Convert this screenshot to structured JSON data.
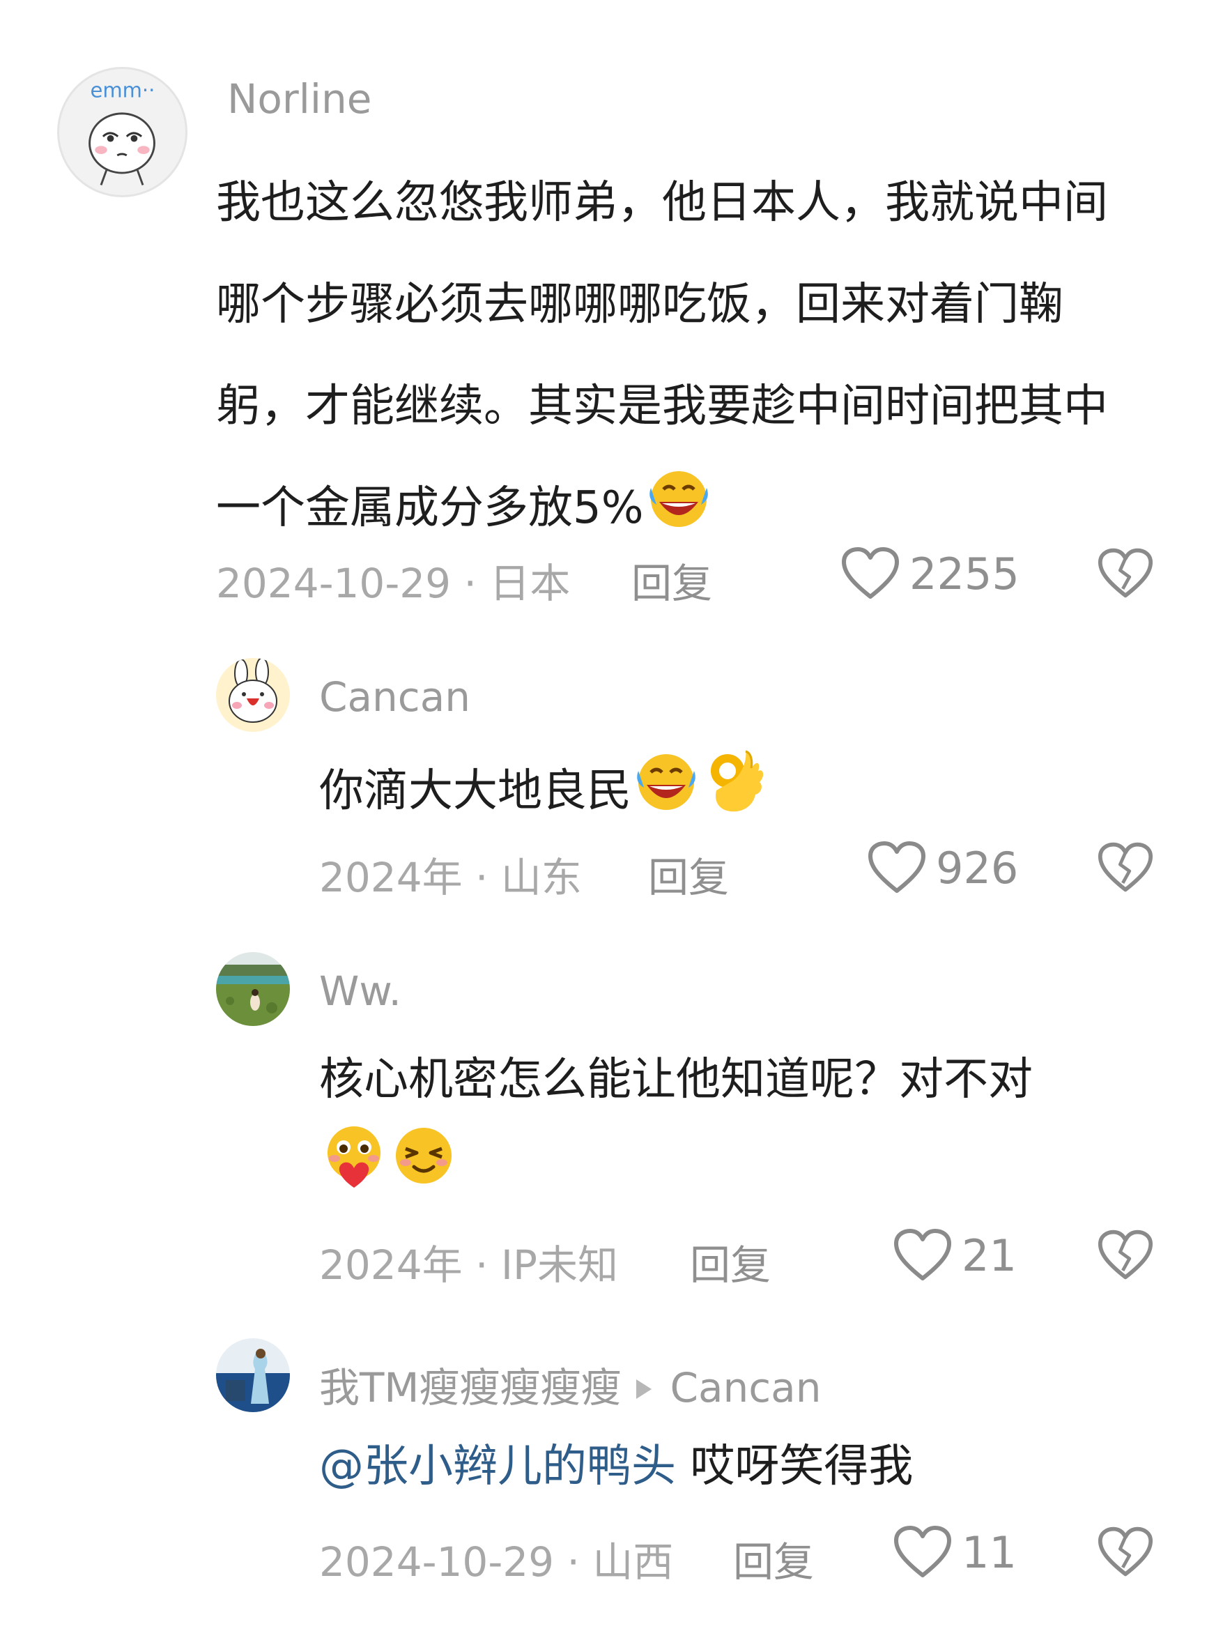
{
  "comments": [
    {
      "username": "Norline",
      "avatar_label": "emm··",
      "text": "我也这么忽悠我师弟，他日本人，我就说中间哪个步骤必须去哪哪哪吃饭，回来对着门鞠躬，才能继续。其实是我要趁中间时间把其中一个金属成分多放5%",
      "emojis": [
        "laughing-crying-emoji"
      ],
      "date_location": "2024-10-29 · 日本",
      "reply_label": "回复",
      "likes": "2255"
    },
    {
      "username": "Cancan",
      "text": "你滴大大地良民",
      "emojis": [
        "laughing-crying-emoji",
        "ok-hand-emoji"
      ],
      "date_location": "2024年 · 山东",
      "reply_label": "回复",
      "likes": "926"
    },
    {
      "username": "Ww.",
      "text": "核心机密怎么能让他知道呢？对不对",
      "emojis": [
        "hugging-heart-emoji",
        "smug-smile-emoji"
      ],
      "date_location": "2024年 · IP未知",
      "reply_label": "回复",
      "likes": "21"
    },
    {
      "username": "我TM瘦瘦瘦瘦瘦",
      "reply_to": "Cancan",
      "mention": "@张小辫儿的鸭头",
      "text": " 哎呀笑得我",
      "date_location": "2024-10-29 · 山西",
      "reply_label": "回复",
      "likes": "11"
    }
  ],
  "colors": {
    "meta_gray": "#a8a8a8",
    "name_gray": "#9a9a9a",
    "mention_blue": "#2f5d8a",
    "body_text": "#1e1e1e"
  }
}
